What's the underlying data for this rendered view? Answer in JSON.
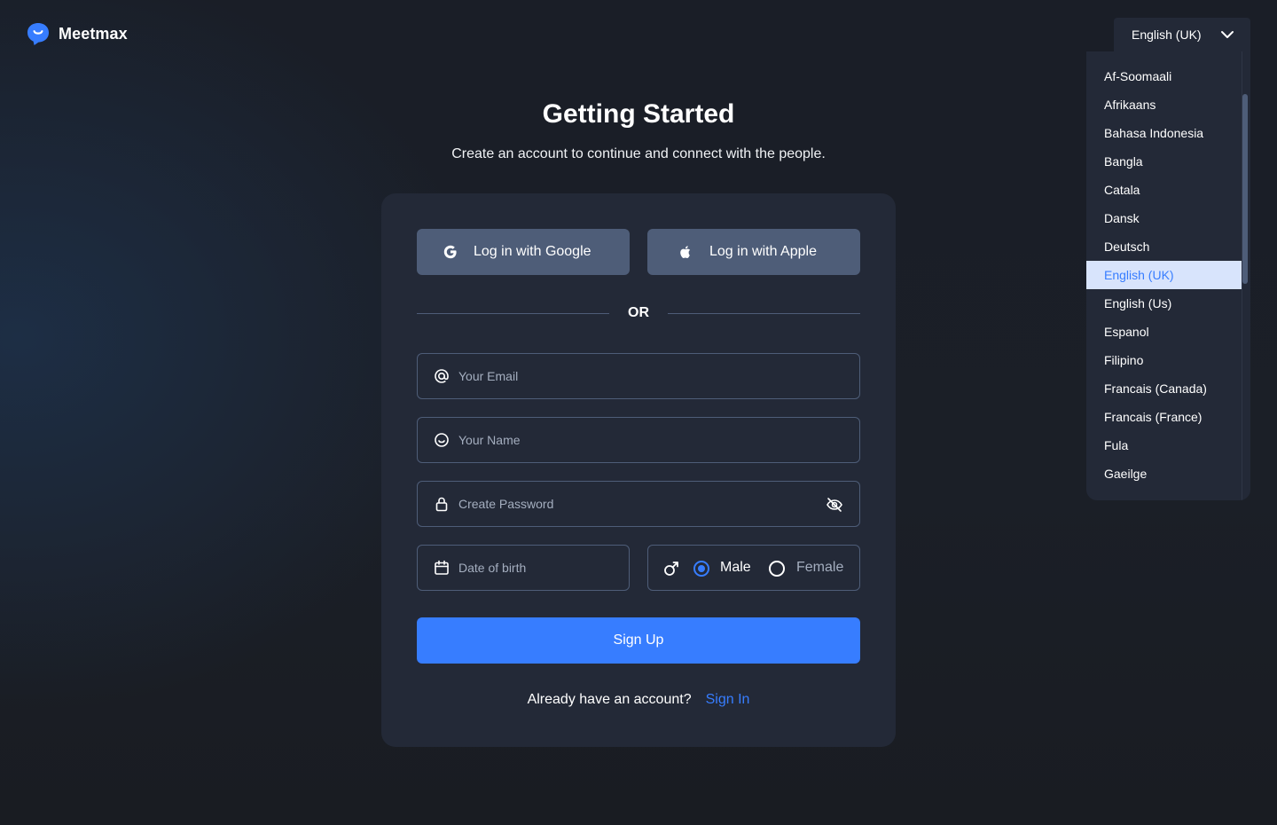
{
  "brand": {
    "name": "Meetmax",
    "logo_icon": "chat-bubble-smile-icon",
    "color": "#377dff"
  },
  "language": {
    "selected": "English (UK)",
    "options": [
      "Af-Soomaali",
      "Afrikaans",
      "Bahasa Indonesia",
      "Bangla",
      "Catala",
      "Dansk",
      "Deutsch",
      "English (UK)",
      "English (Us)",
      "Espanol",
      "Filipino",
      "Francais (Canada)",
      "Francais (France)",
      "Fula",
      "Gaeilge"
    ]
  },
  "header": {
    "title": "Getting Started",
    "subtitle": "Create an account to continue and connect with the people."
  },
  "social": {
    "google_label": "Log in with Google",
    "apple_label": "Log in with Apple"
  },
  "divider": {
    "text": "OR"
  },
  "form": {
    "email_placeholder": "Your Email",
    "name_placeholder": "Your Name",
    "password_placeholder": "Create Password",
    "dob_placeholder": "Date of birth",
    "gender": {
      "options": [
        "Male",
        "Female"
      ],
      "selected": "Male"
    },
    "submit_label": "Sign Up"
  },
  "footer": {
    "question": "Already have an account?",
    "link": "Sign In"
  },
  "colors": {
    "background": "#1b1f27",
    "card": "#232937",
    "border": "#4e5d78",
    "accent": "#377dff",
    "muted": "#a4aebf"
  }
}
